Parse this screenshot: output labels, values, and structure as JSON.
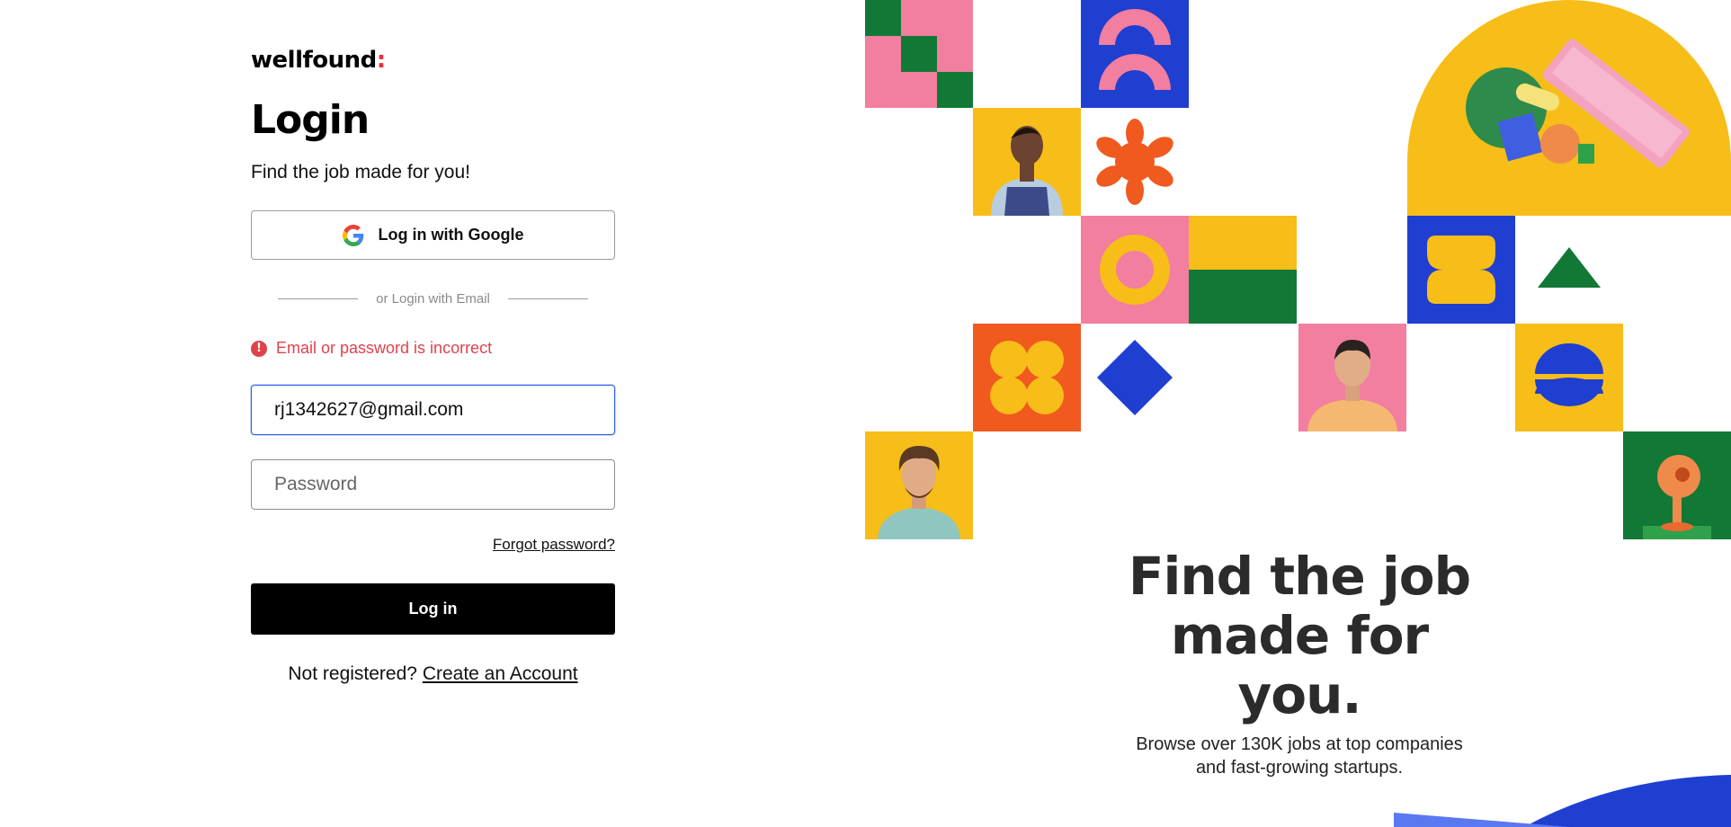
{
  "brand": {
    "name": "wellfound",
    "accent": ":"
  },
  "login": {
    "title": "Login",
    "subtitle": "Find the job made for you!",
    "google_button": "Log in with Google",
    "divider": "or Login with Email",
    "error_message": "Email or password is incorrect",
    "email_value": "rj1342627@gmail.com",
    "password_placeholder": "Password",
    "forgot_password": "Forgot password?",
    "submit_button": "Log in",
    "not_registered": "Not registered?",
    "create_account": "Create an Account"
  },
  "promo": {
    "headline_line1": "Find the job",
    "headline_line2": "made for",
    "headline_line3": "you.",
    "sub_line1": "Browse over 130K jobs at top companies",
    "sub_line2": "and fast-growing startups."
  },
  "colors": {
    "yellow": "#f7bd19",
    "pink": "#f27ea0",
    "green": "#127836",
    "blue": "#1f3fd0",
    "orange": "#f05a1e",
    "error": "#e0424c"
  },
  "icons": [
    "google-icon",
    "error-icon"
  ]
}
